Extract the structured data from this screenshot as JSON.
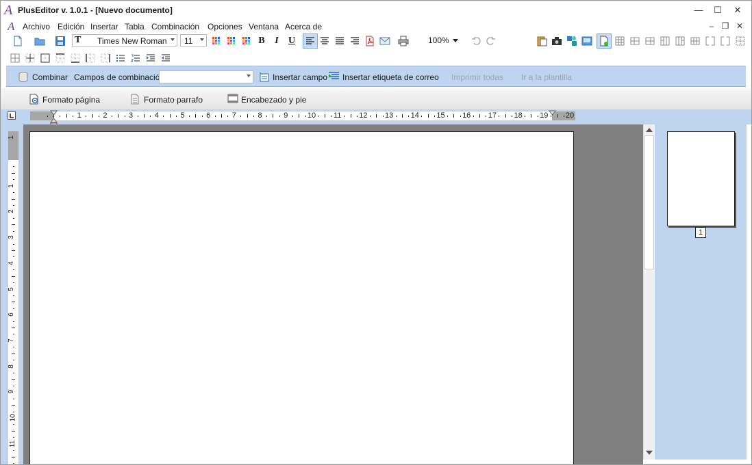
{
  "window": {
    "title": "PlusEditor v. 1.0.1 - [Nuevo documento]",
    "logo_glyph": "A",
    "minimize_glyph": "—",
    "maximize_glyph": "☐",
    "close_glyph": "✕"
  },
  "menu": {
    "items": [
      "Archivo",
      "Edición",
      "Insertar",
      "Tabla",
      "Combinación",
      "Opciones",
      "Ventana",
      "Acerca de"
    ],
    "mdi_min": "–",
    "mdi_restore": "❐",
    "mdi_close": "✕"
  },
  "toolbar": {
    "font_name": "Times New Roman",
    "font_size": "11",
    "bold": "B",
    "italic": "I",
    "underline": "U",
    "zoom": "100%",
    "active_align": "align-left"
  },
  "combine_panel": {
    "combine_label": "Combinar",
    "fields_label": "Campos de combinación",
    "fields_value": "",
    "insert_field_label": "Insertar campo",
    "insert_mail_label": "Insertar etiqueta de correo",
    "print_all_label": "Imprimir todas",
    "go_template_label": "Ir a la plantilla"
  },
  "format_bar": {
    "page_format_label": "Formato página",
    "paragraph_format_label": "Formato parrafo",
    "header_footer_label": "Encabezado y pie"
  },
  "ruler": {
    "horizontal_numbers": [
      "1",
      "2",
      "3",
      "4",
      "5",
      "6",
      "7",
      "8",
      "9",
      "10",
      "11",
      "12",
      "13",
      "14",
      "15",
      "16",
      "17",
      "18",
      "19",
      "20"
    ],
    "vertical_numbers": [
      "1",
      "1",
      "2",
      "3",
      "4",
      "5",
      "6",
      "7",
      "8",
      "9",
      "10",
      "11"
    ]
  },
  "thumbnails": {
    "page_number": "1"
  },
  "colors": {
    "panel_blue": "#bfd4ee",
    "workspace_gray": "#808080",
    "logo_purple": "#6b3fa0"
  }
}
